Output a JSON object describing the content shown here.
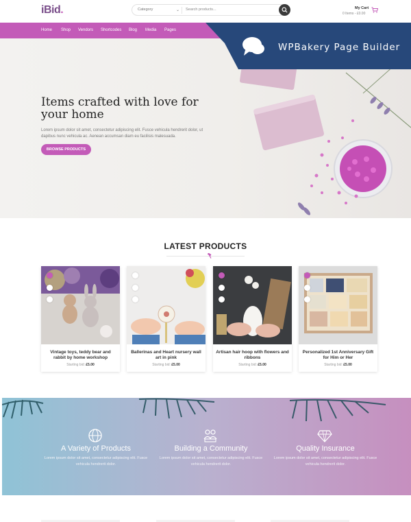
{
  "header": {
    "logo": "iBid",
    "logo_dot": ".",
    "search": {
      "category": "Category",
      "placeholder": "Search products..."
    },
    "cart": {
      "title": "My Cart",
      "summary": "0 Items - £0.00"
    }
  },
  "nav": {
    "items": [
      "Home",
      "Shop",
      "Vendors",
      "Shortcodes",
      "Blog",
      "Media",
      "Pages"
    ]
  },
  "wpbakery": {
    "label": "WPBakery Page Builder"
  },
  "hero": {
    "title": "Items crafted with love for your home",
    "text": "Lorem ipsum dolor sit amet, consectetur adipiscing elit. Fusce vehicula hendrerit dolor, ut dapibus nunc vehicula ac. Aenean accumsan diam eu facilisis malesuada.",
    "button": "BROWSE PRODUCTS"
  },
  "latest": {
    "title": "LATEST PRODUCTS",
    "products": [
      {
        "name": "Vintage toys, teddy bear and rabbit by home workshop",
        "price_label": "Starting bid:",
        "price": "£5.00"
      },
      {
        "name": "Ballerinas and Heart nursery wall art in pink",
        "price_label": "Starting bid:",
        "price": "£5.00"
      },
      {
        "name": "Artisan hair hoop with flowers and ribbons",
        "price_label": "Starting bid:",
        "price": "£5.00"
      },
      {
        "name": "Personalized 1st Anniversary Gift for Him or Her",
        "price_label": "Starting bid:",
        "price": "£5.00"
      }
    ]
  },
  "features": [
    {
      "icon": "globe-icon",
      "title": "A Variety of Products",
      "desc": "Lorem ipsum dolor sit amet, consectetur adipiscing elit. Fusce vehicula hendrerit dolor."
    },
    {
      "icon": "community-icon",
      "title": "Building a Community",
      "desc": "Lorem ipsum dolor sit amet, consectetur adipiscing elit. Fusce vehicula hendrerit dolor."
    },
    {
      "icon": "diamond-icon",
      "title": "Quality Insurance",
      "desc": "Lorem ipsum dolor sit amet, consectetur adipiscing elit. Fusce vehicula hendrerit dolor."
    }
  ],
  "colors": {
    "accent": "#c35bb8",
    "wpbakery": "#27487a"
  }
}
